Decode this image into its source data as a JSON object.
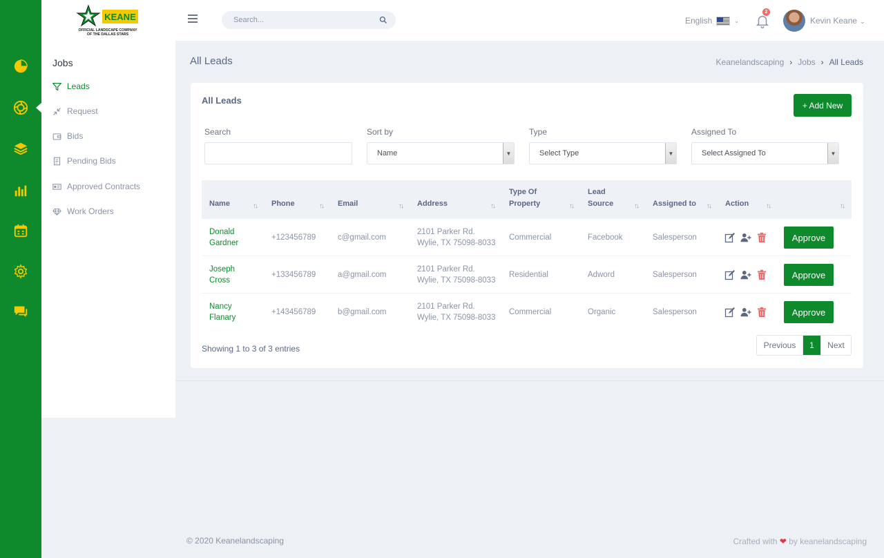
{
  "brand": {
    "logo_alt": "Keane - Official Landscape Company of the Dallas Stars",
    "logo_wordmark": "KEANE",
    "logo_tagline_1": "OFFICIAL LANDSCAPE COMPANY",
    "logo_tagline_2": "OF THE DALLAS STARS",
    "primary_color": "#0e8a2d",
    "accent_color": "#f5c800"
  },
  "rail": {
    "items": [
      {
        "icon": "pie-chart-icon"
      },
      {
        "icon": "aperture-icon",
        "active": true
      },
      {
        "icon": "layers-icon"
      },
      {
        "icon": "bar-chart-icon"
      },
      {
        "icon": "calendar-icon"
      },
      {
        "icon": "gear-icon"
      },
      {
        "icon": "chat-icon"
      }
    ]
  },
  "subnav": {
    "title": "Jobs",
    "items": [
      {
        "label": "Leads",
        "icon": "filter-icon",
        "active": true
      },
      {
        "label": "Request",
        "icon": "compress-icon"
      },
      {
        "label": "Bids",
        "icon": "wallet-icon"
      },
      {
        "label": "Pending Bids",
        "icon": "document-icon"
      },
      {
        "label": "Approved Contracts",
        "icon": "id-card-icon"
      },
      {
        "label": "Work Orders",
        "icon": "diamond-icon"
      }
    ]
  },
  "topbar": {
    "search_placeholder": "Search...",
    "language": "English",
    "notification_count": "2",
    "user_name": "Kevin Keane"
  },
  "page": {
    "title": "All Leads",
    "breadcrumb": [
      "Keanelandscaping",
      "Jobs",
      "All Leads"
    ]
  },
  "card": {
    "title": "All Leads",
    "add_button": "+ Add New",
    "filters": {
      "search_label": "Search",
      "search_value": "",
      "sort_label": "Sort by",
      "sort_value": "Name",
      "type_label": "Type",
      "type_value": "Select Type",
      "assigned_label": "Assigned To",
      "assigned_value": "Select Assigned To"
    },
    "columns": [
      "Name",
      "Phone",
      "Email",
      "Address",
      "Type Of Property",
      "Lead Source",
      "Assigned to",
      "Action",
      ""
    ],
    "rows": [
      {
        "name": "Donald Gardner",
        "phone": "+123456789",
        "email": "c@gmail.com",
        "address": "2101 Parker Rd. Wylie, TX 75098-8033",
        "type": "Commercial",
        "source": "Facebook",
        "assigned": "Salesperson",
        "approve": "Approve"
      },
      {
        "name": "Joseph Cross",
        "phone": "+133456789",
        "email": "a@gmail.com",
        "address": "2101 Parker Rd. Wylie, TX 75098-8033",
        "type": "Residential",
        "source": "Adword",
        "assigned": "Salesperson",
        "approve": "Approve"
      },
      {
        "name": "Nancy Flanary",
        "phone": "+143456789",
        "email": "b@gmail.com",
        "address": "2101 Parker Rd. Wylie, TX 75098-8033",
        "type": "Commercial",
        "source": "Organic",
        "assigned": "Salesperson",
        "approve": "Approve"
      }
    ],
    "showing": "Showing 1 to 3 of 3 entries",
    "pager": {
      "prev": "Previous",
      "page": "1",
      "next": "Next"
    }
  },
  "footer": {
    "left": "© 2020 Keanelandscaping",
    "right_prefix": "Crafted with",
    "right_suffix": "by keanelandscaping"
  }
}
